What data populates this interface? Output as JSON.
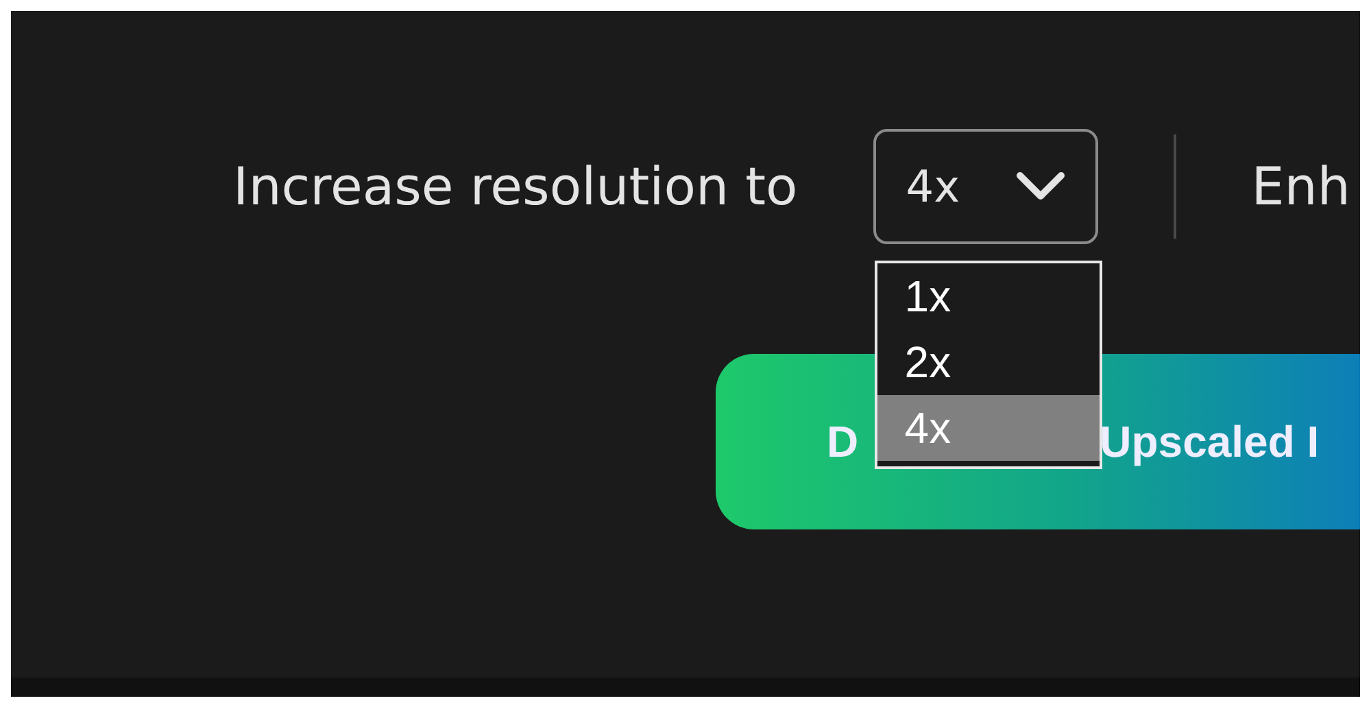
{
  "resolution": {
    "label": "Increase resolution to",
    "value": "4x",
    "expanded": true,
    "options": [
      {
        "label": "1x",
        "selected": false
      },
      {
        "label": "2x",
        "selected": false
      },
      {
        "label": "4x",
        "selected": true
      }
    ]
  },
  "next_label": "Enh",
  "download_button": {
    "label_parts": [
      "D",
      "Upscaled I"
    ]
  }
}
